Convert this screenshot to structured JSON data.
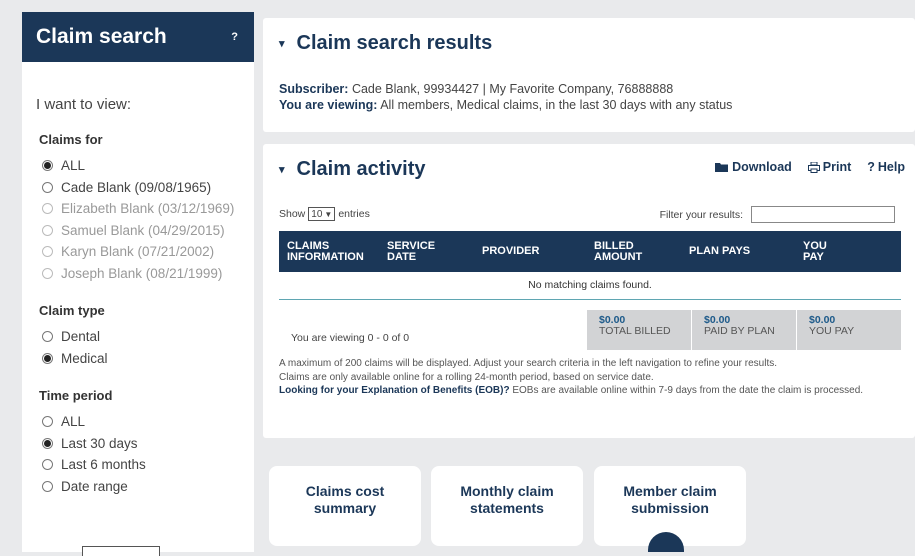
{
  "sidebar": {
    "title": "Claim search",
    "help": "?",
    "i_want_to_view": "I want to view:",
    "claims_for": {
      "title": "Claims for",
      "options": [
        {
          "label": "ALL",
          "selected": true,
          "enabled": true
        },
        {
          "label": "Cade Blank (09/08/1965)",
          "selected": false,
          "enabled": true
        },
        {
          "label": "Elizabeth Blank (03/12/1969)",
          "selected": false,
          "enabled": false
        },
        {
          "label": "Samuel Blank (04/29/2015)",
          "selected": false,
          "enabled": false
        },
        {
          "label": "Karyn Blank (07/21/2002)",
          "selected": false,
          "enabled": false
        },
        {
          "label": "Joseph Blank (08/21/1999)",
          "selected": false,
          "enabled": false
        }
      ]
    },
    "claim_type": {
      "title": "Claim type",
      "options": [
        {
          "label": "Dental",
          "selected": false
        },
        {
          "label": "Medical",
          "selected": true
        }
      ]
    },
    "time_period": {
      "title": "Time period",
      "options": [
        {
          "label": "ALL",
          "selected": false
        },
        {
          "label": "Last 30 days",
          "selected": true
        },
        {
          "label": "Last 6 months",
          "selected": false
        },
        {
          "label": "Date range",
          "selected": false
        }
      ]
    }
  },
  "results": {
    "title": "Claim search results",
    "subscriber_label": "Subscriber:",
    "subscriber_value": "Cade Blank, 99934427 | My Favorite Company, 76888888",
    "viewing_label": "You are viewing:",
    "viewing_value": "All members, Medical claims, in the last 30 days with any status"
  },
  "activity": {
    "title": "Claim activity",
    "download": "Download",
    "print": "Print",
    "help": "Help",
    "show_prefix": "Show",
    "entries_value": "10",
    "show_suffix": "entries",
    "filter_label": "Filter your results:",
    "filter_value": "",
    "columns": [
      [
        "CLAIMS",
        "INFORMATION"
      ],
      [
        "SERVICE",
        "DATE"
      ],
      [
        "PROVIDER",
        ""
      ],
      [
        "BILLED",
        "AMOUNT"
      ],
      [
        "PLAN PAYS",
        ""
      ],
      [
        "YOU",
        "PAY"
      ]
    ],
    "empty_message": "No matching claims found.",
    "viewing_count": "You are viewing 0 - 0 of 0",
    "totals": [
      {
        "amount": "$0.00",
        "label": "TOTAL BILLED"
      },
      {
        "amount": "$0.00",
        "label": "PAID BY PLAN"
      },
      {
        "amount": "$0.00",
        "label": "YOU PAY"
      }
    ],
    "note1": "A maximum of 200 claims will be displayed. Adjust your search criteria in the left navigation to refine your results.",
    "note2": "Claims are only available online for a rolling 24-month period, based on service date.",
    "note3_bold": "Looking for your Explanation of Benefits (EOB)?",
    "note3_rest": "EOBs are available online within 7-9 days from the date the claim is processed."
  },
  "tiles": [
    {
      "line1": "Claims cost",
      "line2": "summary"
    },
    {
      "line1": "Monthly claim",
      "line2": "statements"
    },
    {
      "line1": "Member claim",
      "line2": "submission"
    }
  ],
  "colors": {
    "brand_navy": "#1b3758",
    "accent_teal": "#5fa6b2",
    "background": "#e9eaec"
  }
}
